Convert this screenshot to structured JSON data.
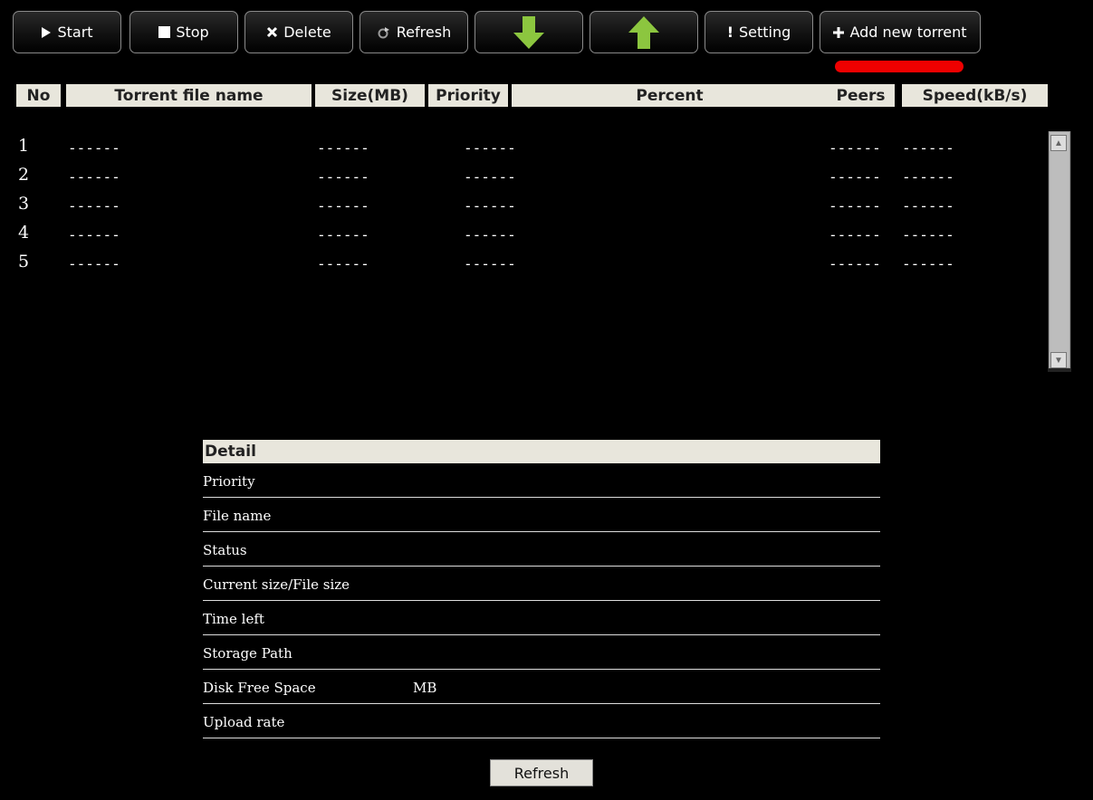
{
  "toolbar": {
    "start": "Start",
    "stop": "Stop",
    "delete": "Delete",
    "refresh": "Refresh",
    "setting": "Setting",
    "add": "Add new torrent"
  },
  "table": {
    "headers": {
      "no": "No",
      "name": "Torrent file name",
      "size": "Size(MB)",
      "priority": "Priority",
      "percent": "Percent",
      "peers": "Peers",
      "speed": "Speed(kB/s)"
    },
    "rows": [
      {
        "no": "1",
        "name": "------",
        "size": "------",
        "priority": "------",
        "peers": "------",
        "speed": "------"
      },
      {
        "no": "2",
        "name": "------",
        "size": "------",
        "priority": "------",
        "peers": "------",
        "speed": "------"
      },
      {
        "no": "3",
        "name": "------",
        "size": "------",
        "priority": "------",
        "peers": "------",
        "speed": "------"
      },
      {
        "no": "4",
        "name": "------",
        "size": "------",
        "priority": "------",
        "peers": "------",
        "speed": "------"
      },
      {
        "no": "5",
        "name": "------",
        "size": "------",
        "priority": "------",
        "peers": "------",
        "speed": "------"
      }
    ]
  },
  "detail": {
    "title": "Detail",
    "rows": [
      {
        "label": "Priority",
        "value": ""
      },
      {
        "label": "File name",
        "value": ""
      },
      {
        "label": "Status",
        "value": ""
      },
      {
        "label": "Current size/File size",
        "value": ""
      },
      {
        "label": "Time left",
        "value": ""
      },
      {
        "label": "Storage Path",
        "value": ""
      },
      {
        "label": "Disk Free Space",
        "value": "MB"
      },
      {
        "label": "Upload rate",
        "value": ""
      }
    ],
    "refresh": "Refresh"
  },
  "colors": {
    "background": "#000000",
    "header_bg": "#e8e6dc",
    "arrow_green": "#8cc63f",
    "highlight_red": "#ee0000"
  }
}
